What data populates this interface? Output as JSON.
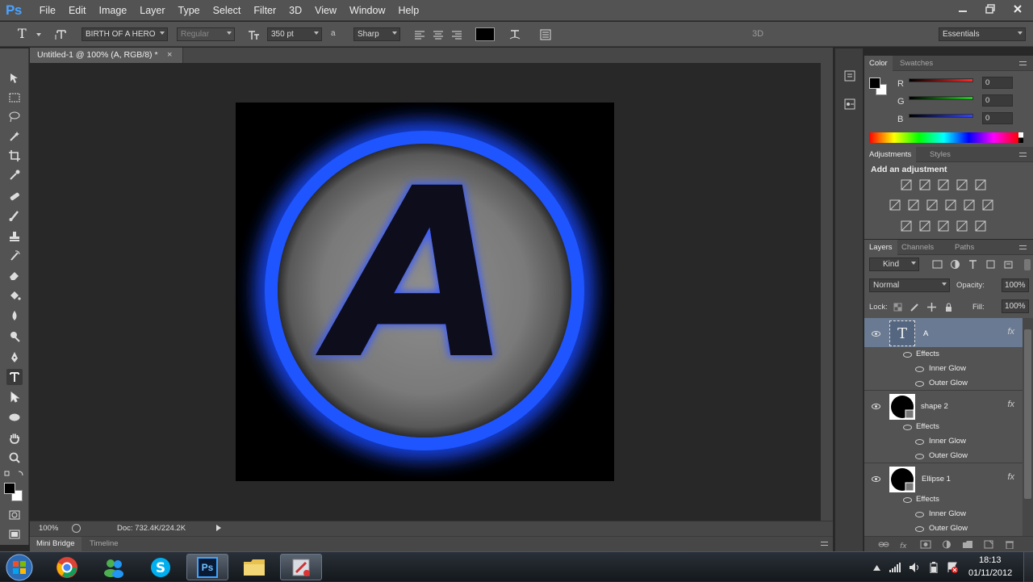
{
  "app": {
    "logo": "Ps",
    "window_controls": [
      "minimize-icon",
      "restore-icon",
      "close-icon"
    ]
  },
  "menu": [
    "File",
    "Edit",
    "Image",
    "Layer",
    "Type",
    "Select",
    "Filter",
    "3D",
    "View",
    "Window",
    "Help"
  ],
  "options": {
    "tool_glyph": "T",
    "font_family": "BIRTH OF A HERO",
    "font_style": "Regular",
    "font_size": "350 pt",
    "aa_label": "a",
    "antialias": "Sharp",
    "text_color": "#000000",
    "mode_3d": "3D",
    "workspace": "Essentials"
  },
  "document": {
    "tab_title": "Untitled-1 @ 100% (A, RGB/8) *",
    "canvas_glyph": "A",
    "glow_color": "#1a4cff"
  },
  "status": {
    "zoom": "100%",
    "doc": "Doc: 732.4K/224.2K"
  },
  "bottom_tabs": [
    "Mini Bridge",
    "Timeline"
  ],
  "color_panel": {
    "tabs": [
      "Color",
      "Swatches"
    ],
    "channels": [
      {
        "label": "R",
        "value": "0",
        "color": "#ff2a2a"
      },
      {
        "label": "G",
        "value": "0",
        "color": "#22cc22"
      },
      {
        "label": "B",
        "value": "0",
        "color": "#3344ff"
      }
    ]
  },
  "adjust_panel": {
    "tabs": [
      "Adjustments",
      "Styles"
    ],
    "title": "Add an adjustment"
  },
  "layers_panel": {
    "tabs": [
      "Layers",
      "Channels",
      "Paths"
    ],
    "filter": "Kind",
    "blend_mode": "Normal",
    "opacity_label": "Opacity:",
    "opacity": "100%",
    "lock_label": "Lock:",
    "fill_label": "Fill:",
    "fill": "100%",
    "thumb_glyph": "T",
    "fx": "fx",
    "layers": [
      {
        "name": "A",
        "effects_label": "Effects",
        "effects": [
          "Inner Glow",
          "Outer Glow"
        ]
      },
      {
        "name": "shape 2",
        "effects_label": "Effects",
        "effects": [
          "Inner Glow",
          "Outer Glow"
        ]
      },
      {
        "name": "Ellipse 1",
        "effects_label": "Effects",
        "effects": [
          "Inner Glow",
          "Outer Glow"
        ]
      }
    ]
  },
  "taskbar": {
    "apps": [
      "start-orb-icon",
      "chrome-icon",
      "messenger-icon",
      "skype-icon",
      "photoshop-icon",
      "folder-icon",
      "paint-icon"
    ],
    "ps_label": "Ps",
    "time": "18:13",
    "date": "01/11/2012"
  }
}
